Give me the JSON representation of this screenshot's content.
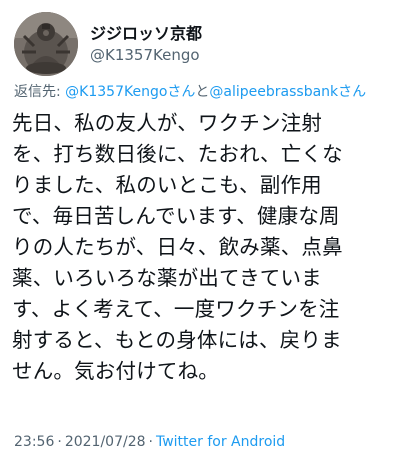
{
  "user": {
    "display_name": "ジジロッソ京都",
    "handle": "@K1357Kengo"
  },
  "reply": {
    "prefix": "返信先: ",
    "mention1": "@K1357Kengoさん",
    "joiner": "と",
    "mention2": "@alipeebrassbankさん"
  },
  "tweet": {
    "text": "先日、私の友人が、ワクチン注射\nを、打ち数日後に、たおれ、亡くな\nりました、私のいとこも、副作用\nで、毎日苦しんでいます、健康な周\nりの人たちが、日々、飲み薬、点鼻\n薬、いろいろな薬が出てきていま\nす、よく考えて、一度ワクチンを注\n射すると、もとの身体には、戻りま\nせん。気お付けてね。"
  },
  "meta": {
    "time": "23:56",
    "separator1": "·",
    "date": "2021/07/28",
    "separator2": "·",
    "source": "Twitter for Android"
  },
  "colors": {
    "text": "#0f1419",
    "secondary": "#536471",
    "link": "#1d9bf0"
  }
}
